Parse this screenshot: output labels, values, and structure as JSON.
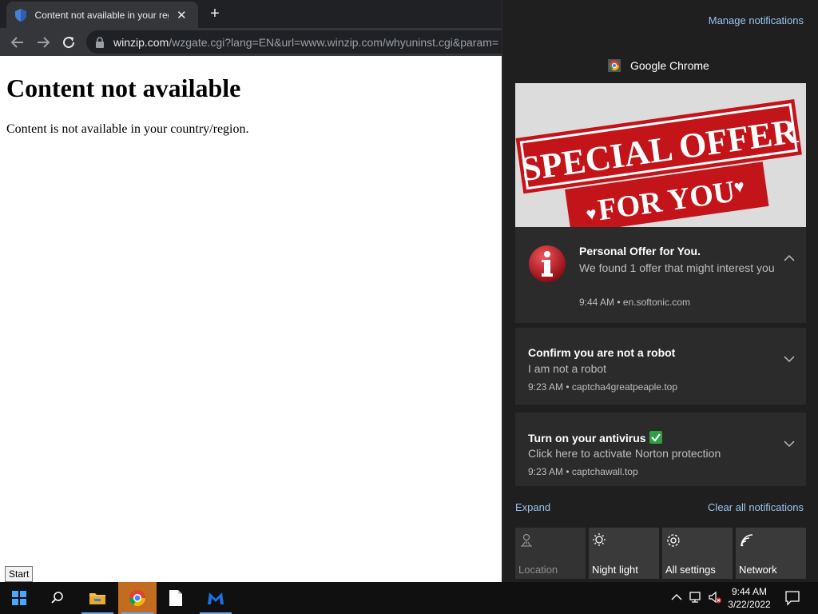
{
  "browser": {
    "tab_title": "Content not available in your region",
    "url_host": "winzip.com",
    "url_path": "/wzgate.cgi?lang=EN&url=www.winzip.com/whyuninst.cgi&param="
  },
  "page": {
    "heading": "Content not available",
    "message": "Content is not available in your country/region."
  },
  "tooltip": {
    "start": "Start"
  },
  "action_center": {
    "manage": "Manage notifications",
    "app_name": "Google Chrome",
    "hero_text": {
      "line1": "SPECIAL OFFER",
      "line2": "FOR YOU"
    },
    "notifications": [
      {
        "title": "Personal Offer for You.",
        "body": "We found 1 offer that might interest you",
        "time": "9:44 AM",
        "source": "en.softonic.com"
      },
      {
        "title": "Confirm you are not a robot",
        "body": "I am not a robot",
        "time": "9:23 AM",
        "source": "captcha4greatpeaple.top"
      },
      {
        "title": "Turn on your antivirus",
        "body": "Click here to activate Norton protection",
        "time": "9:23 AM",
        "source": "captchawall.top"
      }
    ],
    "meta_separator": "•",
    "expand": "Expand",
    "clear_all": "Clear all notifications",
    "quick_actions": [
      {
        "label": "Location",
        "icon": "location-icon",
        "state": "off"
      },
      {
        "label": "Night light",
        "icon": "night-light-icon",
        "state": "on"
      },
      {
        "label": "All settings",
        "icon": "gear-icon",
        "state": "on"
      },
      {
        "label": "Network",
        "icon": "network-icon",
        "state": "on"
      }
    ]
  },
  "taskbar": {
    "time": "9:44 AM",
    "date": "3/22/2022",
    "apps": [
      "windows-start-icon",
      "search-icon",
      "file-explorer-icon",
      "chrome-icon",
      "notepad-icon",
      "malwarebytes-icon"
    ]
  },
  "colors": {
    "accent_link": "#99c5ee",
    "panel_bg": "#1f1f1f",
    "card_bg": "#2b2b2b",
    "active_app": "#c36b1f"
  }
}
